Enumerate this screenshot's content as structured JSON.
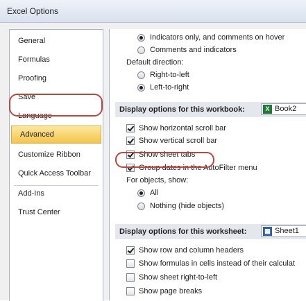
{
  "window": {
    "title": "Excel Options"
  },
  "nav": {
    "items": [
      {
        "label": "General"
      },
      {
        "label": "Formulas"
      },
      {
        "label": "Proofing"
      },
      {
        "label": "Save"
      },
      {
        "label": "Language"
      },
      {
        "label": "Advanced",
        "selected": true
      },
      {
        "label": "Customize Ribbon"
      },
      {
        "label": "Quick Access Toolbar"
      },
      {
        "label": "Add-Ins"
      },
      {
        "label": "Trust Center"
      }
    ]
  },
  "comments": {
    "option_indicators_only": "Indicators only, and comments on hover",
    "option_comments_and_indicators": "Comments and indicators",
    "selected": "Indicators only, and comments on hover"
  },
  "direction": {
    "label": "Default direction:",
    "option_rtl": "Right-to-left",
    "option_ltr": "Left-to-right",
    "selected": "Left-to-right"
  },
  "workbook": {
    "header": "Display options for this workbook:",
    "selected_workbook": "Book2",
    "icon": "excel-workbook-icon",
    "options": [
      {
        "label": "Show horizontal scroll bar",
        "checked": true
      },
      {
        "label": "Show vertical scroll bar",
        "checked": true
      },
      {
        "label": "Show sheet tabs",
        "checked": true
      },
      {
        "label": "Group dates in the AutoFilter menu",
        "checked": true
      }
    ],
    "objects_label": "For objects, show:",
    "objects_all": "All",
    "objects_nothing": "Nothing (hide objects)",
    "objects_selected": "All"
  },
  "worksheet": {
    "header": "Display options for this worksheet:",
    "selected_sheet": "Sheet1",
    "options": [
      {
        "label": "Show row and column headers",
        "checked": true
      },
      {
        "label": "Show formulas in cells instead of their calculat",
        "checked": false
      },
      {
        "label": "Show sheet right-to-left",
        "checked": false
      },
      {
        "label": "Show page breaks",
        "checked": false
      }
    ]
  },
  "colors": {
    "highlight_ring": "#b8473c",
    "nav_selected": "#f5c54d"
  }
}
